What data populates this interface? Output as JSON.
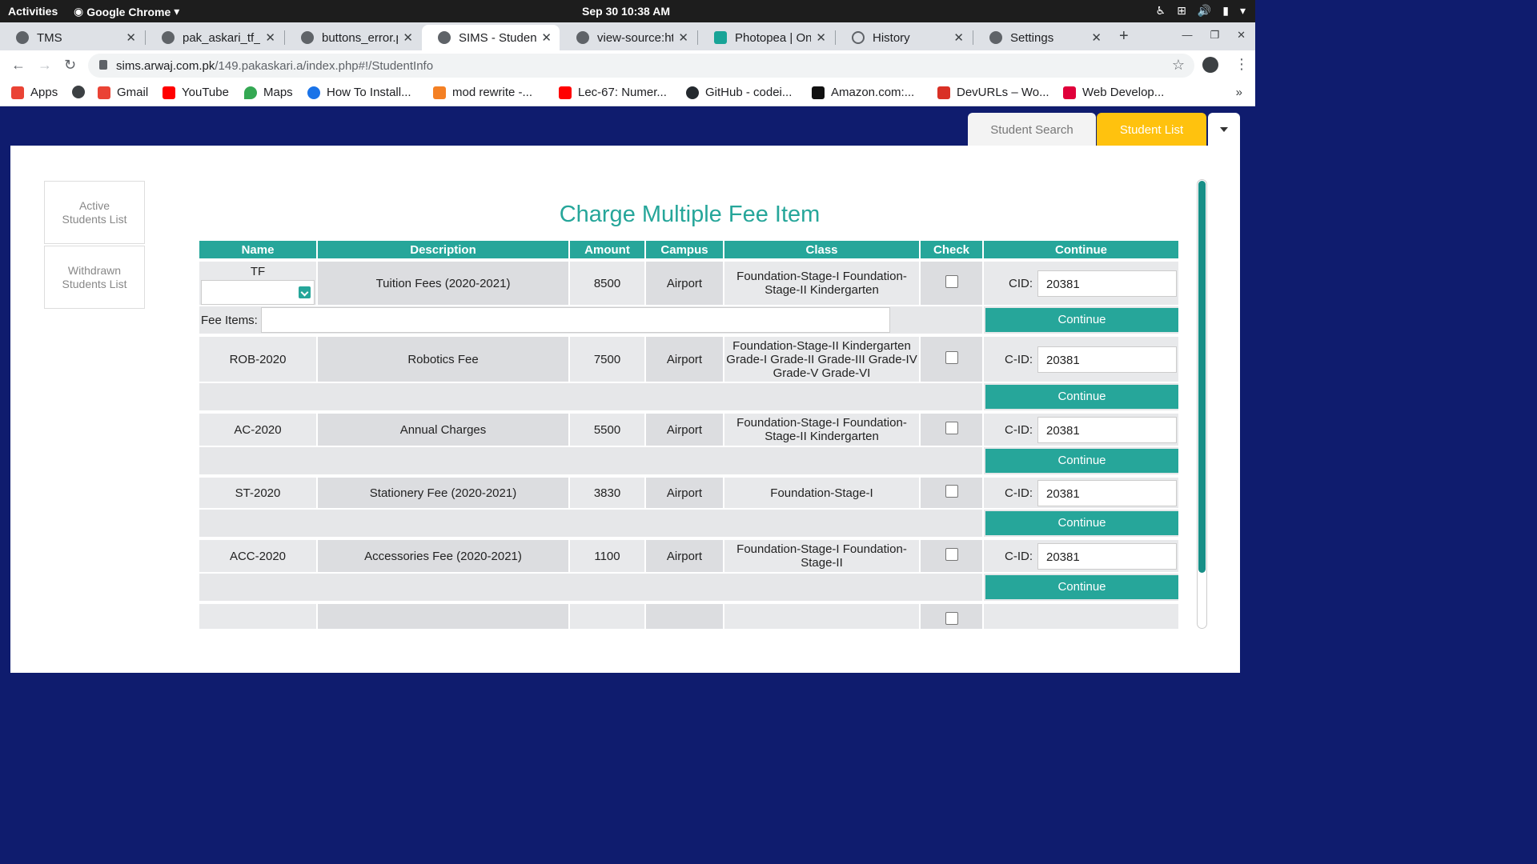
{
  "topbar": {
    "activities": "Activities",
    "app": "Google Chrome",
    "clock": "Sep 30  10:38 AM"
  },
  "tabs": [
    {
      "title": "TMS"
    },
    {
      "title": "pak_askari_tf_i"
    },
    {
      "title": "buttons_error.p"
    },
    {
      "title": "SIMS - Student"
    },
    {
      "title": "view-source:ht"
    },
    {
      "title": "Photopea | Onl"
    },
    {
      "title": "History"
    },
    {
      "title": "Settings"
    }
  ],
  "address": {
    "domain": "sims.arwaj.com.pk",
    "path": "/149.pakaskari.a/index.php#!/StudentInfo"
  },
  "bookmarks": [
    {
      "label": "Apps",
      "color": "#ea4335"
    },
    {
      "label": "",
      "color": "#3c4043"
    },
    {
      "label": "Gmail",
      "color": "#ea4335"
    },
    {
      "label": "YouTube",
      "color": "#ff0000"
    },
    {
      "label": "Maps",
      "color": "#34a853"
    },
    {
      "label": "How To Install...",
      "color": "#1a73e8"
    },
    {
      "label": "mod rewrite -...",
      "color": "#f48024"
    },
    {
      "label": "Lec-67: Numer...",
      "color": "#ff0000"
    },
    {
      "label": "GitHub - codei...",
      "color": "#24292e"
    },
    {
      "label": "Amazon.com:...",
      "color": "#111111"
    },
    {
      "label": "DevURLs – Wo...",
      "color": "#d93025"
    },
    {
      "label": "Web Develop...",
      "color": "#e0003a"
    }
  ],
  "page_tabs": {
    "search": "Student Search",
    "list": "Student List"
  },
  "sidenav": {
    "active": "Active Students List",
    "withdrawn": "Withdrawn Students List"
  },
  "title": "Charge Multiple Fee Item",
  "table": {
    "headers": [
      "Name",
      "Description",
      "Amount",
      "Campus",
      "Class",
      "Check",
      "Continue"
    ],
    "fee_items_label": "Fee Items:",
    "continue_label": "Continue",
    "rows": [
      {
        "name": "TF",
        "description": "Tuition Fees (2020-2021)",
        "amount": "8500",
        "campus": "Airport",
        "class": "Foundation-Stage-I Foundation-Stage-II Kindergarten",
        "cid_label": "CID:",
        "cid": "20381"
      },
      {
        "name": "ROB-2020",
        "description": "Robotics Fee",
        "amount": "7500",
        "campus": "Airport",
        "class": "Foundation-Stage-II Kindergarten Grade-I Grade-II Grade-III Grade-IV Grade-V Grade-VI",
        "cid_label": "C-ID:",
        "cid": "20381"
      },
      {
        "name": "AC-2020",
        "description": "Annual Charges",
        "amount": "5500",
        "campus": "Airport",
        "class": "Foundation-Stage-I Foundation-Stage-II Kindergarten",
        "cid_label": "C-ID:",
        "cid": "20381"
      },
      {
        "name": "ST-2020",
        "description": "Stationery Fee (2020-2021)",
        "amount": "3830",
        "campus": "Airport",
        "class": "Foundation-Stage-I",
        "cid_label": "C-ID:",
        "cid": "20381"
      },
      {
        "name": "ACC-2020",
        "description": "Accessories Fee (2020-2021)",
        "amount": "1100",
        "campus": "Airport",
        "class": "Foundation-Stage-I Foundation-Stage-II",
        "cid_label": "C-ID:",
        "cid": "20381"
      }
    ]
  },
  "colors": {
    "teal": "#26a69a",
    "navy": "#0f1c6e",
    "amber": "#ffc20e"
  }
}
